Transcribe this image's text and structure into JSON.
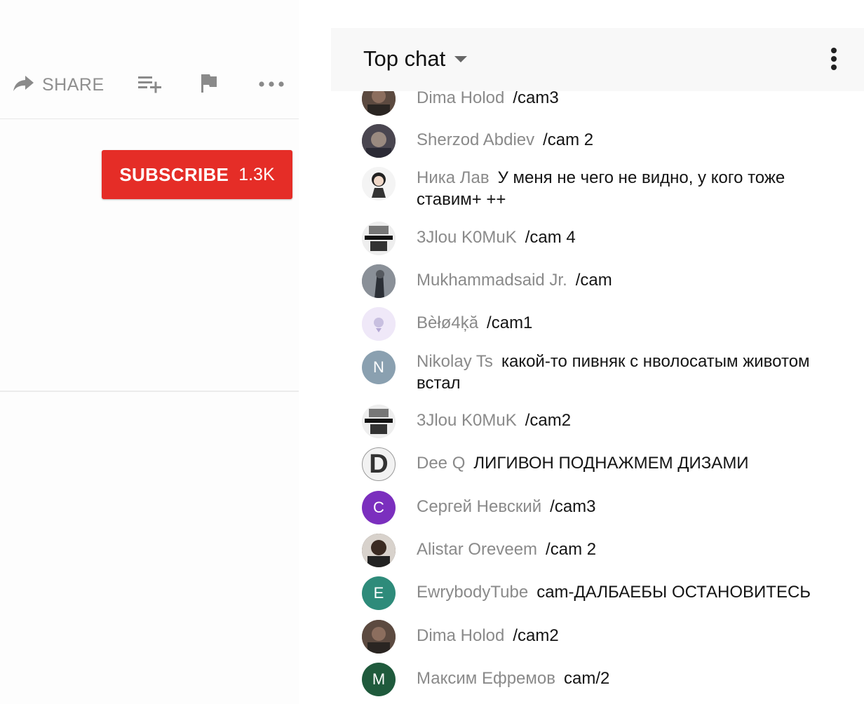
{
  "actions": {
    "share_label": "SHARE"
  },
  "subscribe": {
    "label": "SUBSCRIBE",
    "count": "1.3K"
  },
  "chat": {
    "title": "Top chat",
    "messages": [
      {
        "author": "Dima Holod",
        "text": "/cam3"
      },
      {
        "author": "Sherzod Abdiev",
        "text": "/cam 2"
      },
      {
        "author": "Ника Лав",
        "text": "У меня не чего не видно, у кого тоже ставим+ ++"
      },
      {
        "author": "3Jlou K0MuK",
        "text": "/cam 4"
      },
      {
        "author": "Mukhammadsaid Jr.",
        "text": "/cam"
      },
      {
        "author": "Bèłø4ķă",
        "text": "/cam1"
      },
      {
        "author": "Nikolay Ts",
        "text": "какой-то пивняк с нволосатым животом встал",
        "initial": "N"
      },
      {
        "author": "3Jlou K0MuK",
        "text": "/cam2"
      },
      {
        "author": "Dee Q",
        "text": "ЛИГИВОН ПОДНАЖМЕМ ДИЗАМИ",
        "initial": "D"
      },
      {
        "author": "Сергей Невский",
        "text": "/cam3",
        "initial": "C"
      },
      {
        "author": "Alistar Oreveem",
        "text": "/cam 2"
      },
      {
        "author": "EwrybodyTube",
        "text": "cam-ДАЛБАЕБЫ ОСТАНОВИТЕСЬ",
        "initial": "E"
      },
      {
        "author": "Dima Holod",
        "text": "/cam2"
      },
      {
        "author": "Максим Ефремов",
        "text": "cam/2",
        "initial": "M"
      }
    ]
  },
  "colors": {
    "subscribe": "#e52d27",
    "author": "#8a8a8a",
    "avatar_nikolay": "#8aa0b0",
    "avatar_sergey": "#7b2fbe",
    "avatar_ewrybody": "#2e8b7a",
    "avatar_maksim": "#1f5a3c"
  }
}
